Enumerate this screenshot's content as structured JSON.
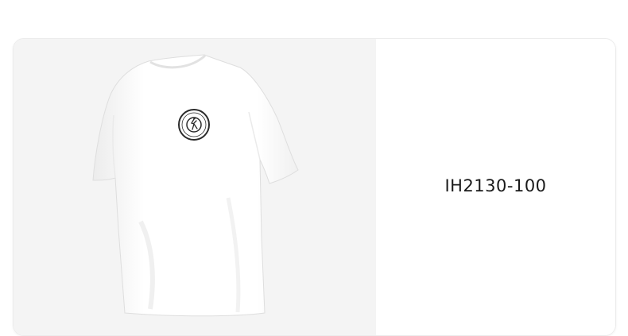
{
  "product": {
    "sku": "IH2130-100",
    "image_icon": "white-tshirt-product-photo",
    "logo_icon": "jumpman-circle-logo"
  },
  "colors": {
    "image_background": "#f4f4f4",
    "card_background": "#ffffff",
    "shirt": "#ffffff",
    "text": "#1a1a1a"
  }
}
